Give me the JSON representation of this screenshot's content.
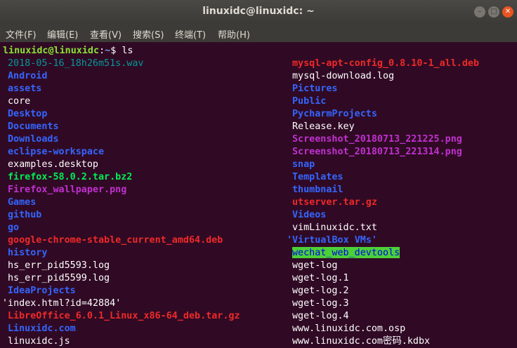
{
  "window": {
    "title": "linuxidc@linuxidc: ~",
    "minimize": "–",
    "maximize": "□",
    "close": "✕"
  },
  "menu": [
    "文件(F)",
    "编辑(E)",
    "查看(V)",
    "搜索(S)",
    "终端(T)",
    "帮助(H)"
  ],
  "prompt": {
    "user_host": "linuxidc@linuxidc",
    "colon": ":",
    "path": "~",
    "symbol": "$",
    "command": "ls"
  },
  "left_column": [
    {
      "name": "2018-05-16_18h26m51s.wav",
      "kind": "media"
    },
    {
      "name": "Android",
      "kind": "dir"
    },
    {
      "name": "assets",
      "kind": "dir"
    },
    {
      "name": "core",
      "kind": "plain"
    },
    {
      "name": "Desktop",
      "kind": "dir"
    },
    {
      "name": "Documents",
      "kind": "dir"
    },
    {
      "name": "Downloads",
      "kind": "dir"
    },
    {
      "name": "eclipse-workspace",
      "kind": "dir"
    },
    {
      "name": "examples.desktop",
      "kind": "plain"
    },
    {
      "name": "firefox-58.0.2.tar.bz2",
      "kind": "exe"
    },
    {
      "name": "Firefox_wallpaper.png",
      "kind": "img"
    },
    {
      "name": "Games",
      "kind": "dir"
    },
    {
      "name": "github",
      "kind": "dir"
    },
    {
      "name": "go",
      "kind": "dir"
    },
    {
      "name": "google-chrome-stable_current_amd64.deb",
      "kind": "arch"
    },
    {
      "name": "history",
      "kind": "dir"
    },
    {
      "name": "hs_err_pid5593.log",
      "kind": "plain"
    },
    {
      "name": "hs_err_pid5599.log",
      "kind": "plain"
    },
    {
      "name": "IdeaProjects",
      "kind": "dir"
    },
    {
      "name": "'index.html?id=42884'",
      "kind": "plain"
    },
    {
      "name": "LibreOffice_6.0.1_Linux_x86-64_deb.tar.gz",
      "kind": "arch"
    },
    {
      "name": "Linuxidc.com",
      "kind": "dir"
    },
    {
      "name": "linuxidc.js",
      "kind": "plain"
    }
  ],
  "right_column": [
    {
      "name": "mysql-apt-config_0.8.10-1_all.deb",
      "kind": "arch"
    },
    {
      "name": "mysql-download.log",
      "kind": "plain"
    },
    {
      "name": "Pictures",
      "kind": "dir"
    },
    {
      "name": "Public",
      "kind": "dir"
    },
    {
      "name": "PycharmProjects",
      "kind": "dir"
    },
    {
      "name": "Release.key",
      "kind": "plain"
    },
    {
      "name": "Screenshot_20180713_221225.png",
      "kind": "img"
    },
    {
      "name": "Screenshot_20180713_221314.png",
      "kind": "img"
    },
    {
      "name": "snap",
      "kind": "dir"
    },
    {
      "name": "Templates",
      "kind": "dir"
    },
    {
      "name": "thumbnail",
      "kind": "dir"
    },
    {
      "name": "utserver.tar.gz",
      "kind": "arch"
    },
    {
      "name": "Videos",
      "kind": "dir"
    },
    {
      "name": "vimLinuxidc.txt",
      "kind": "plain"
    },
    {
      "name": "'VirtualBox VMs'",
      "kind": "dir"
    },
    {
      "name": "wechat_web_devtools",
      "kind": "ow"
    },
    {
      "name": "wget-log",
      "kind": "plain"
    },
    {
      "name": "wget-log.1",
      "kind": "plain"
    },
    {
      "name": "wget-log.2",
      "kind": "plain"
    },
    {
      "name": "wget-log.3",
      "kind": "plain"
    },
    {
      "name": "wget-log.4",
      "kind": "plain"
    },
    {
      "name": "www.linuxidc.com.osp",
      "kind": "plain"
    },
    {
      "name": "www.linuxidc.com密码.kdbx",
      "kind": "plain"
    }
  ],
  "colors": {
    "background": "#300a24",
    "prompt_user": "#8ae234",
    "prompt_path": "#729fcf",
    "directory": "#3465ff",
    "archive": "#ef2929",
    "image": "#c030d0",
    "executable": "#00ee55",
    "media": "#06989a",
    "other_writable_bg": "#4cd038"
  }
}
